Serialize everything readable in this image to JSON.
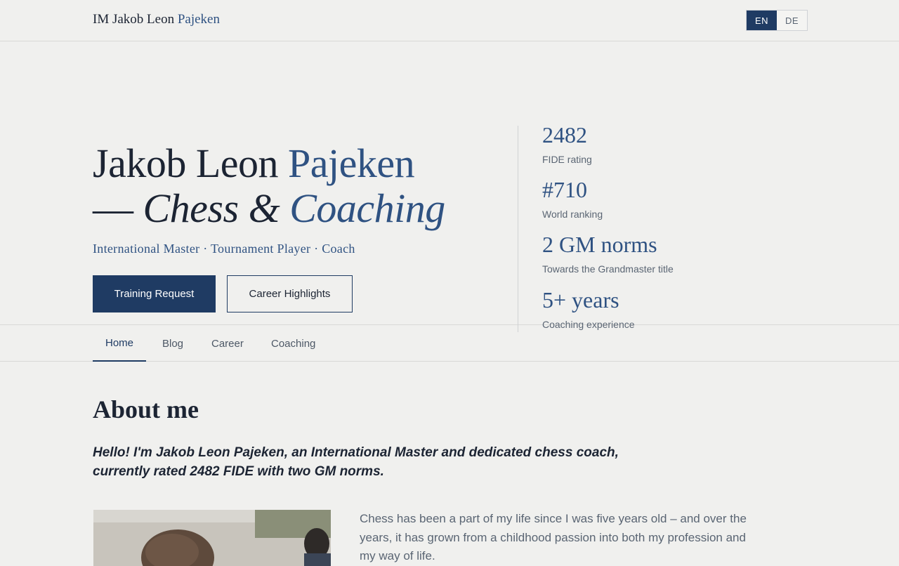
{
  "header": {
    "brand_main": "IM Jakob Leon",
    "brand_accent": "Pajeken",
    "lang_en": "EN",
    "lang_de": "DE"
  },
  "hero": {
    "name_first": "Jakob Leon",
    "name_last": "Pajeken",
    "line2_dash": "—",
    "line2_chess": "Chess &",
    "line2_coaching": "Coaching",
    "subtitle": "International Master · Tournament Player · Coach",
    "primary_button": "Training Request",
    "secondary_button": "Career Highlights"
  },
  "stats": [
    {
      "value": "2482",
      "label": "FIDE rating"
    },
    {
      "value": "#710",
      "label": "World ranking"
    },
    {
      "value": "2 GM norms",
      "label": "Towards the Grandmaster title"
    },
    {
      "value": "5+ years",
      "label": "Coaching experience"
    }
  ],
  "nav": {
    "items": [
      "Home",
      "Blog",
      "Career",
      "Coaching"
    ],
    "active": "Home"
  },
  "about": {
    "title": "About me",
    "lead": "Hello! I'm Jakob Leon Pajeken, an International Master and dedicated chess coach, currently rated 2482 FIDE with two GM norms.",
    "paragraph": "Chess has been a part of my life since I was five years old – and over the years, it has grown from a childhood passion into both my profession and my way of life."
  },
  "colors": {
    "background": "#f0f0ee",
    "accent": "#2f5282",
    "primary": "#1f3b63",
    "text": "#1c2433",
    "muted": "#5a6573"
  }
}
